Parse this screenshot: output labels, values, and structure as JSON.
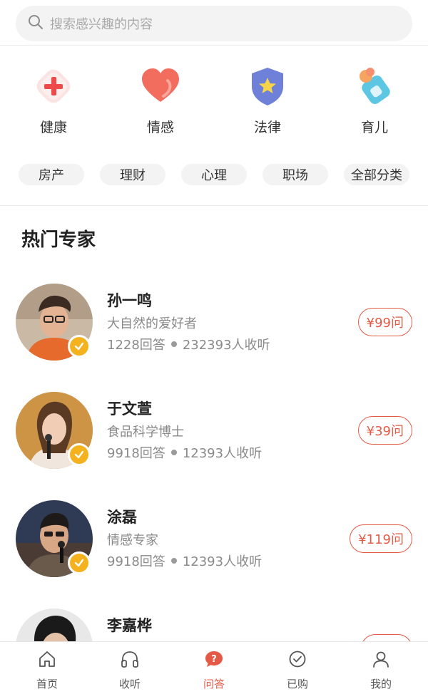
{
  "search": {
    "placeholder": "搜索感兴趣的内容"
  },
  "categories": [
    {
      "label": "健康",
      "icon": "health-cross-icon",
      "color": "#f04a4a"
    },
    {
      "label": "情感",
      "icon": "heart-icon",
      "color": "#f06a5c"
    },
    {
      "label": "法律",
      "icon": "law-shield-icon",
      "color": "#6d7fd6"
    },
    {
      "label": "育儿",
      "icon": "baby-bottle-icon",
      "color": "#58c4e0"
    }
  ],
  "tags": [
    "房产",
    "理财",
    "心理",
    "职场",
    "全部分类"
  ],
  "section_title": "热门专家",
  "experts": [
    {
      "name": "孙一鸣",
      "desc": "大自然的爱好者",
      "answers": "1228回答",
      "listeners": "232393人收听",
      "price": "¥99问"
    },
    {
      "name": "于文萱",
      "desc": "食品科学博士",
      "answers": "9918回答",
      "listeners": "12393人收听",
      "price": "¥39问"
    },
    {
      "name": "涂磊",
      "desc": "情感专家",
      "answers": "9918回答",
      "listeners": "12393人收听",
      "price": "¥119问"
    },
    {
      "name": "李嘉桦",
      "desc": "",
      "answers": "",
      "listeners": "",
      "price": ""
    }
  ],
  "tabbar": [
    {
      "label": "首页",
      "icon": "home-icon"
    },
    {
      "label": "收听",
      "icon": "headphones-icon"
    },
    {
      "label": "问答",
      "icon": "qa-bubble-icon",
      "active": true
    },
    {
      "label": "已购",
      "icon": "check-circle-icon"
    },
    {
      "label": "我的",
      "icon": "user-icon"
    }
  ],
  "colors": {
    "accent": "#e45a47",
    "verify": "#f3b21e"
  }
}
